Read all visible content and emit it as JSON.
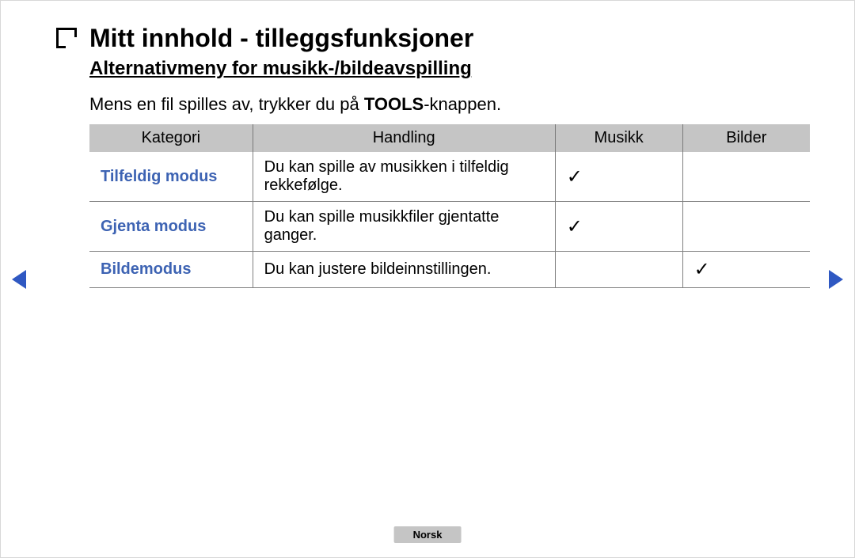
{
  "page": {
    "title": "Mitt innhold - tilleggsfunksjoner",
    "subtitle": "Alternativmeny for musikk-/bildeavspilling",
    "intro_prefix": "Mens en fil spilles av, trykker du på ",
    "intro_bold": "TOOLS",
    "intro_suffix": "-knappen."
  },
  "table": {
    "headers": {
      "category": "Kategori",
      "action": "Handling",
      "music": "Musikk",
      "pictures": "Bilder"
    },
    "rows": [
      {
        "category": "Tilfeldig modus",
        "action": "Du kan spille av musikken i tilfeldig rekkefølge.",
        "music": "✓",
        "pictures": ""
      },
      {
        "category": "Gjenta modus",
        "action": "Du kan spille musikkfiler gjentatte ganger.",
        "music": "✓",
        "pictures": ""
      },
      {
        "category": "Bildemodus",
        "action": "Du kan justere bildeinnstillingen.",
        "music": "",
        "pictures": "✓"
      }
    ]
  },
  "footer": {
    "language": "Norsk"
  }
}
